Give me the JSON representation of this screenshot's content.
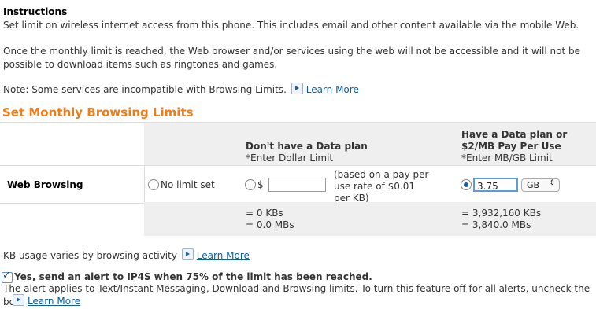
{
  "instructions": {
    "title": "Instructions",
    "line1": "Set limit on wireless internet access from this phone. This includes email and other content available via the mobile Web.",
    "line2a": "Once the monthly limit is reached, the Web browser and/or services using the web will not be accessible and it will not be",
    "line2b": "possible to download items such as ringtones and games.",
    "note": "Note: Some services are incompatible with Browsing Limits.",
    "learn_more": "Learn More"
  },
  "section_title": "Set Monthly Browsing Limits",
  "columns": {
    "no_data": {
      "title": "Don't have a Data plan",
      "sub": "*Enter Dollar Limit"
    },
    "data": {
      "title1": "Have a Data plan or",
      "title2": "$2/MB Pay Per Use",
      "sub": "*Enter MB/GB Limit"
    }
  },
  "row": {
    "label": "Web Browsing",
    "no_limit": "No limit set",
    "dollar_symbol": "$",
    "dollar_value": "",
    "rate_note1": "(based on a pay per",
    "rate_note2": "use rate of $0.01",
    "rate_note3": "per KB)",
    "limit_value": "3.75",
    "unit": "GB",
    "selected_option": "data-limit"
  },
  "totals": {
    "no_data_kb": "= 0 KBs",
    "no_data_mb": "= 0.0 MBs",
    "data_kb": "= 3,932,160 KBs",
    "data_mb": "= 3,840.0 MBs"
  },
  "kb_note": "KB usage varies by browsing activity",
  "alert": {
    "checked": true,
    "label": "Yes, send an alert to IP4S when 75% of the limit has been reached.",
    "desc": "The alert applies to Text/Instant Messaging, Download and Browsing limits. To turn this feature off for all alerts, uncheck the box."
  },
  "icons": {
    "learn_more": "play-arrow-icon",
    "select": "updown-arrows-icon",
    "checkbox": "checkmark-icon"
  },
  "colors": {
    "accent": "#f07c16",
    "link": "#0b5fa5",
    "gray_cell": "#efefef"
  }
}
